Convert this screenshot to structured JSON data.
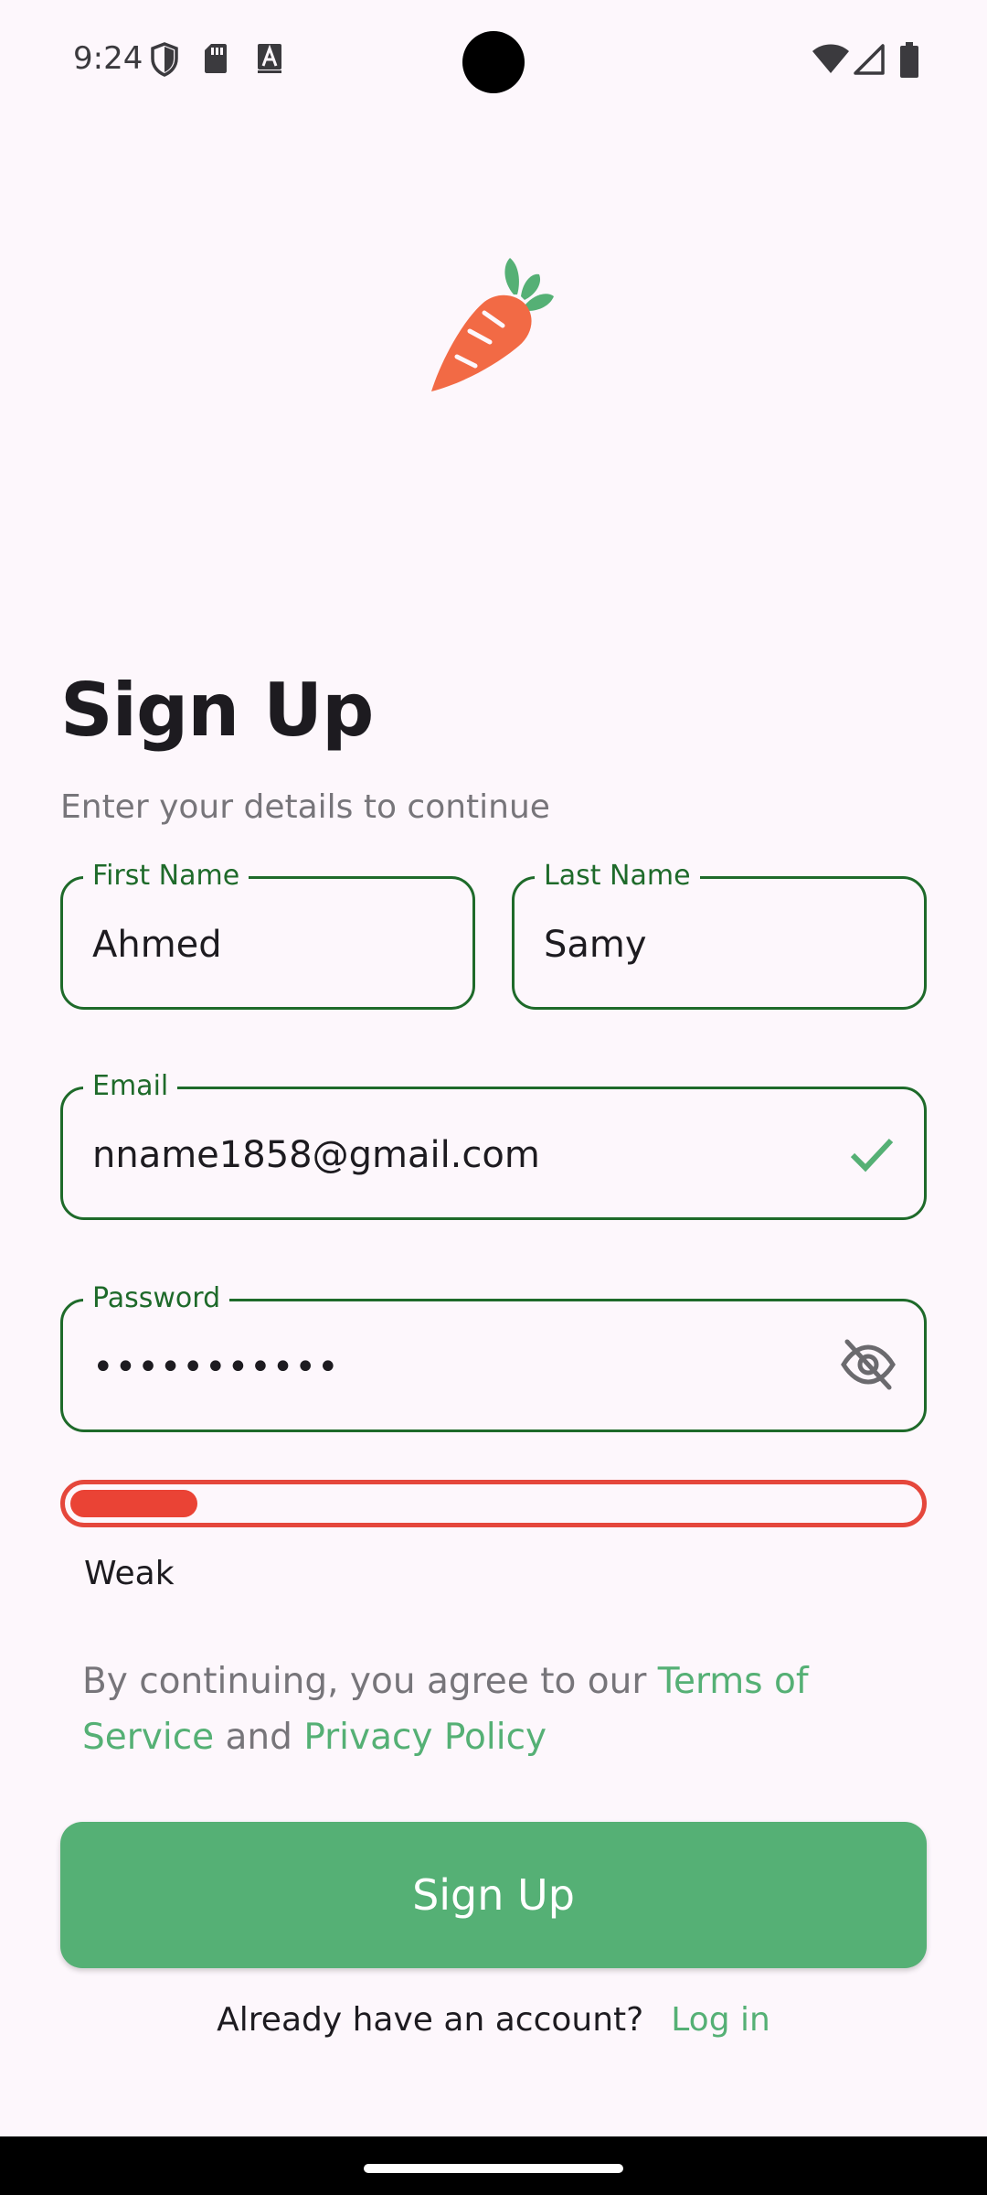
{
  "status_bar": {
    "time": "9:24",
    "left_icons": [
      "shield-icon",
      "sd-card-icon",
      "text-a-icon"
    ],
    "right_icons": [
      "wifi-icon",
      "signal-icon",
      "battery-icon"
    ]
  },
  "logo": {
    "icon": "carrot-icon"
  },
  "header": {
    "title": "Sign Up",
    "subtitle": "Enter your details to continue"
  },
  "form": {
    "first_name": {
      "label": "First Name",
      "value": "Ahmed"
    },
    "last_name": {
      "label": "Last Name",
      "value": "Samy"
    },
    "email": {
      "label": "Email",
      "value": "nname1858@gmail.com",
      "icon": "check-icon"
    },
    "password": {
      "label": "Password",
      "value": "•••••••••••",
      "icon": "eye-off-icon"
    },
    "strength": {
      "level": 0.15,
      "label": "Weak",
      "color": "#ea4335"
    }
  },
  "terms": {
    "prefix": "By continuing, you agree to our ",
    "terms_link": "Terms of Service",
    "middle": " and ",
    "privacy_link": "Privacy Policy"
  },
  "actions": {
    "signup_label": "Sign Up",
    "login_prompt": "Already have an account?",
    "login_link": "Log in"
  },
  "colors": {
    "accent": "#55b075",
    "field_border": "#1e6a2a",
    "background": "#fdf7fc",
    "weak": "#ea4335"
  }
}
